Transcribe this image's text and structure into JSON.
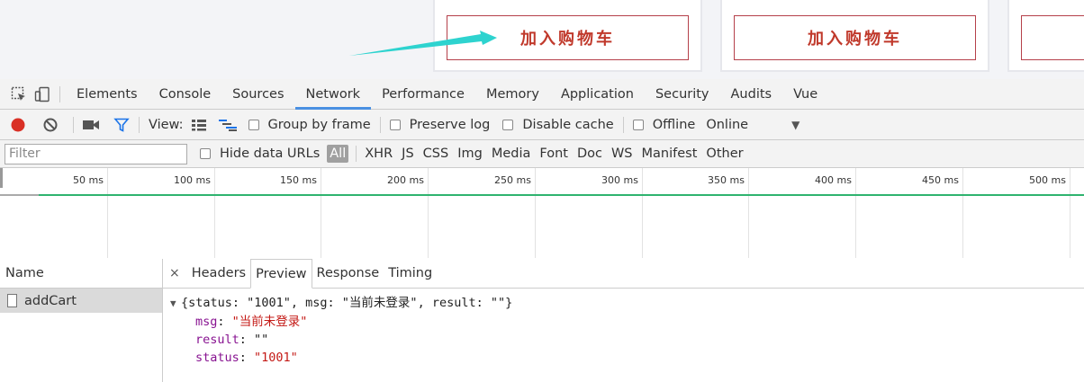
{
  "page": {
    "add_cart_buttons": [
      "加入购物车",
      "加入购物车",
      ""
    ]
  },
  "devtools": {
    "tabs": [
      "Elements",
      "Console",
      "Sources",
      "Network",
      "Performance",
      "Memory",
      "Application",
      "Security",
      "Audits",
      "Vue"
    ],
    "active_tab": "Network",
    "toolbar": {
      "view_label": "View:",
      "group_by_frame": "Group by frame",
      "preserve_log": "Preserve log",
      "disable_cache": "Disable cache",
      "offline": "Offline",
      "throttle": "Online"
    },
    "filterbar": {
      "filter_placeholder": "Filter",
      "hide_data_urls": "Hide data URLs",
      "types": [
        "All",
        "XHR",
        "JS",
        "CSS",
        "Img",
        "Media",
        "Font",
        "Doc",
        "WS",
        "Manifest",
        "Other"
      ]
    },
    "timeline_ticks": [
      "50 ms",
      "100 ms",
      "150 ms",
      "200 ms",
      "250 ms",
      "300 ms",
      "350 ms",
      "400 ms",
      "450 ms",
      "500 ms"
    ],
    "requests": {
      "header": "Name",
      "items": [
        "addCart"
      ]
    },
    "detail": {
      "close": "×",
      "tabs": [
        "Headers",
        "Preview",
        "Response",
        "Timing"
      ],
      "active_tab": "Preview",
      "preview": {
        "summary": "{status: \"1001\", msg: \"当前未登录\", result: \"\"}",
        "fields": [
          {
            "key": "msg",
            "value": "\"当前未登录\""
          },
          {
            "key": "result",
            "value": "\"\""
          },
          {
            "key": "status",
            "value": "\"1001\""
          }
        ]
      }
    }
  },
  "colors": {
    "cart_button_text": "#c0392b",
    "active_tab_underline": "#4a90e2",
    "record": "#d93025",
    "filter_icon": "#1a73e8",
    "timeline_bar": "#2fb36f",
    "arrow": "#2ed3cf"
  }
}
